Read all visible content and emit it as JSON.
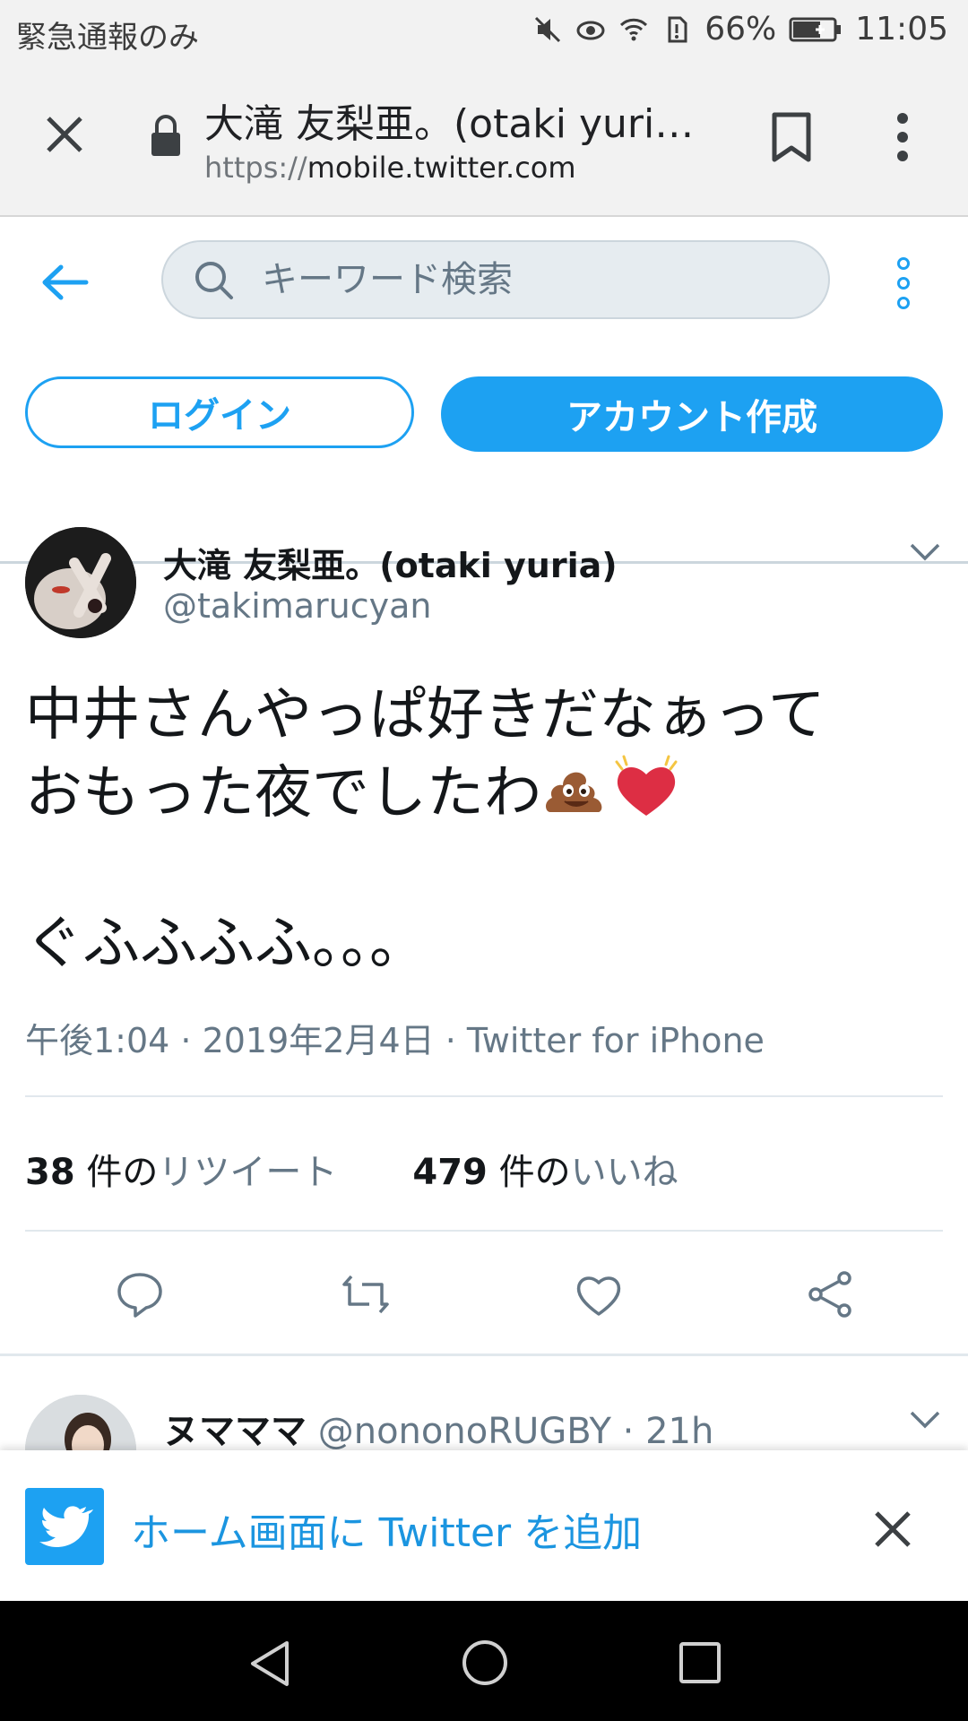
{
  "status_bar": {
    "left_text": "緊急通報のみ",
    "battery": "66%",
    "time": "11:05",
    "icons": [
      "mute-icon",
      "eye-comfort-icon",
      "wifi-icon",
      "no-sim-icon",
      "battery-icon"
    ]
  },
  "browser": {
    "page_title": "大滝 友梨亜。(otaki yuri…",
    "url_scheme": "https://",
    "url_host": "mobile.twitter.com"
  },
  "header": {
    "search_placeholder": "キーワード検索",
    "login_label": "ログイン",
    "signup_label": "アカウント作成"
  },
  "tweet": {
    "display_name": "大滝 友梨亜。(otaki yuria)",
    "handle": "@takimarucyan",
    "text_line1": "中井さんやっぱ好きだなぁって",
    "text_line2": "おもった夜でしたわ",
    "text_line3": "ぐふふふふ。。。",
    "meta": "午後1:04 · 2019年2月4日 · Twitter for iPhone",
    "retweet_count": "38",
    "retweet_unit": "件の",
    "retweet_label": "リツイート",
    "like_count": "479",
    "like_unit": "件の",
    "like_label": "いいね"
  },
  "reply": {
    "display_name": "ヌマママ",
    "handle": "@nononoRUGBY",
    "time": "21h"
  },
  "banner": {
    "text": "ホーム画面に Twitter を追加"
  },
  "colors": {
    "accent": "#1da1f2",
    "text_secondary": "#657786"
  }
}
